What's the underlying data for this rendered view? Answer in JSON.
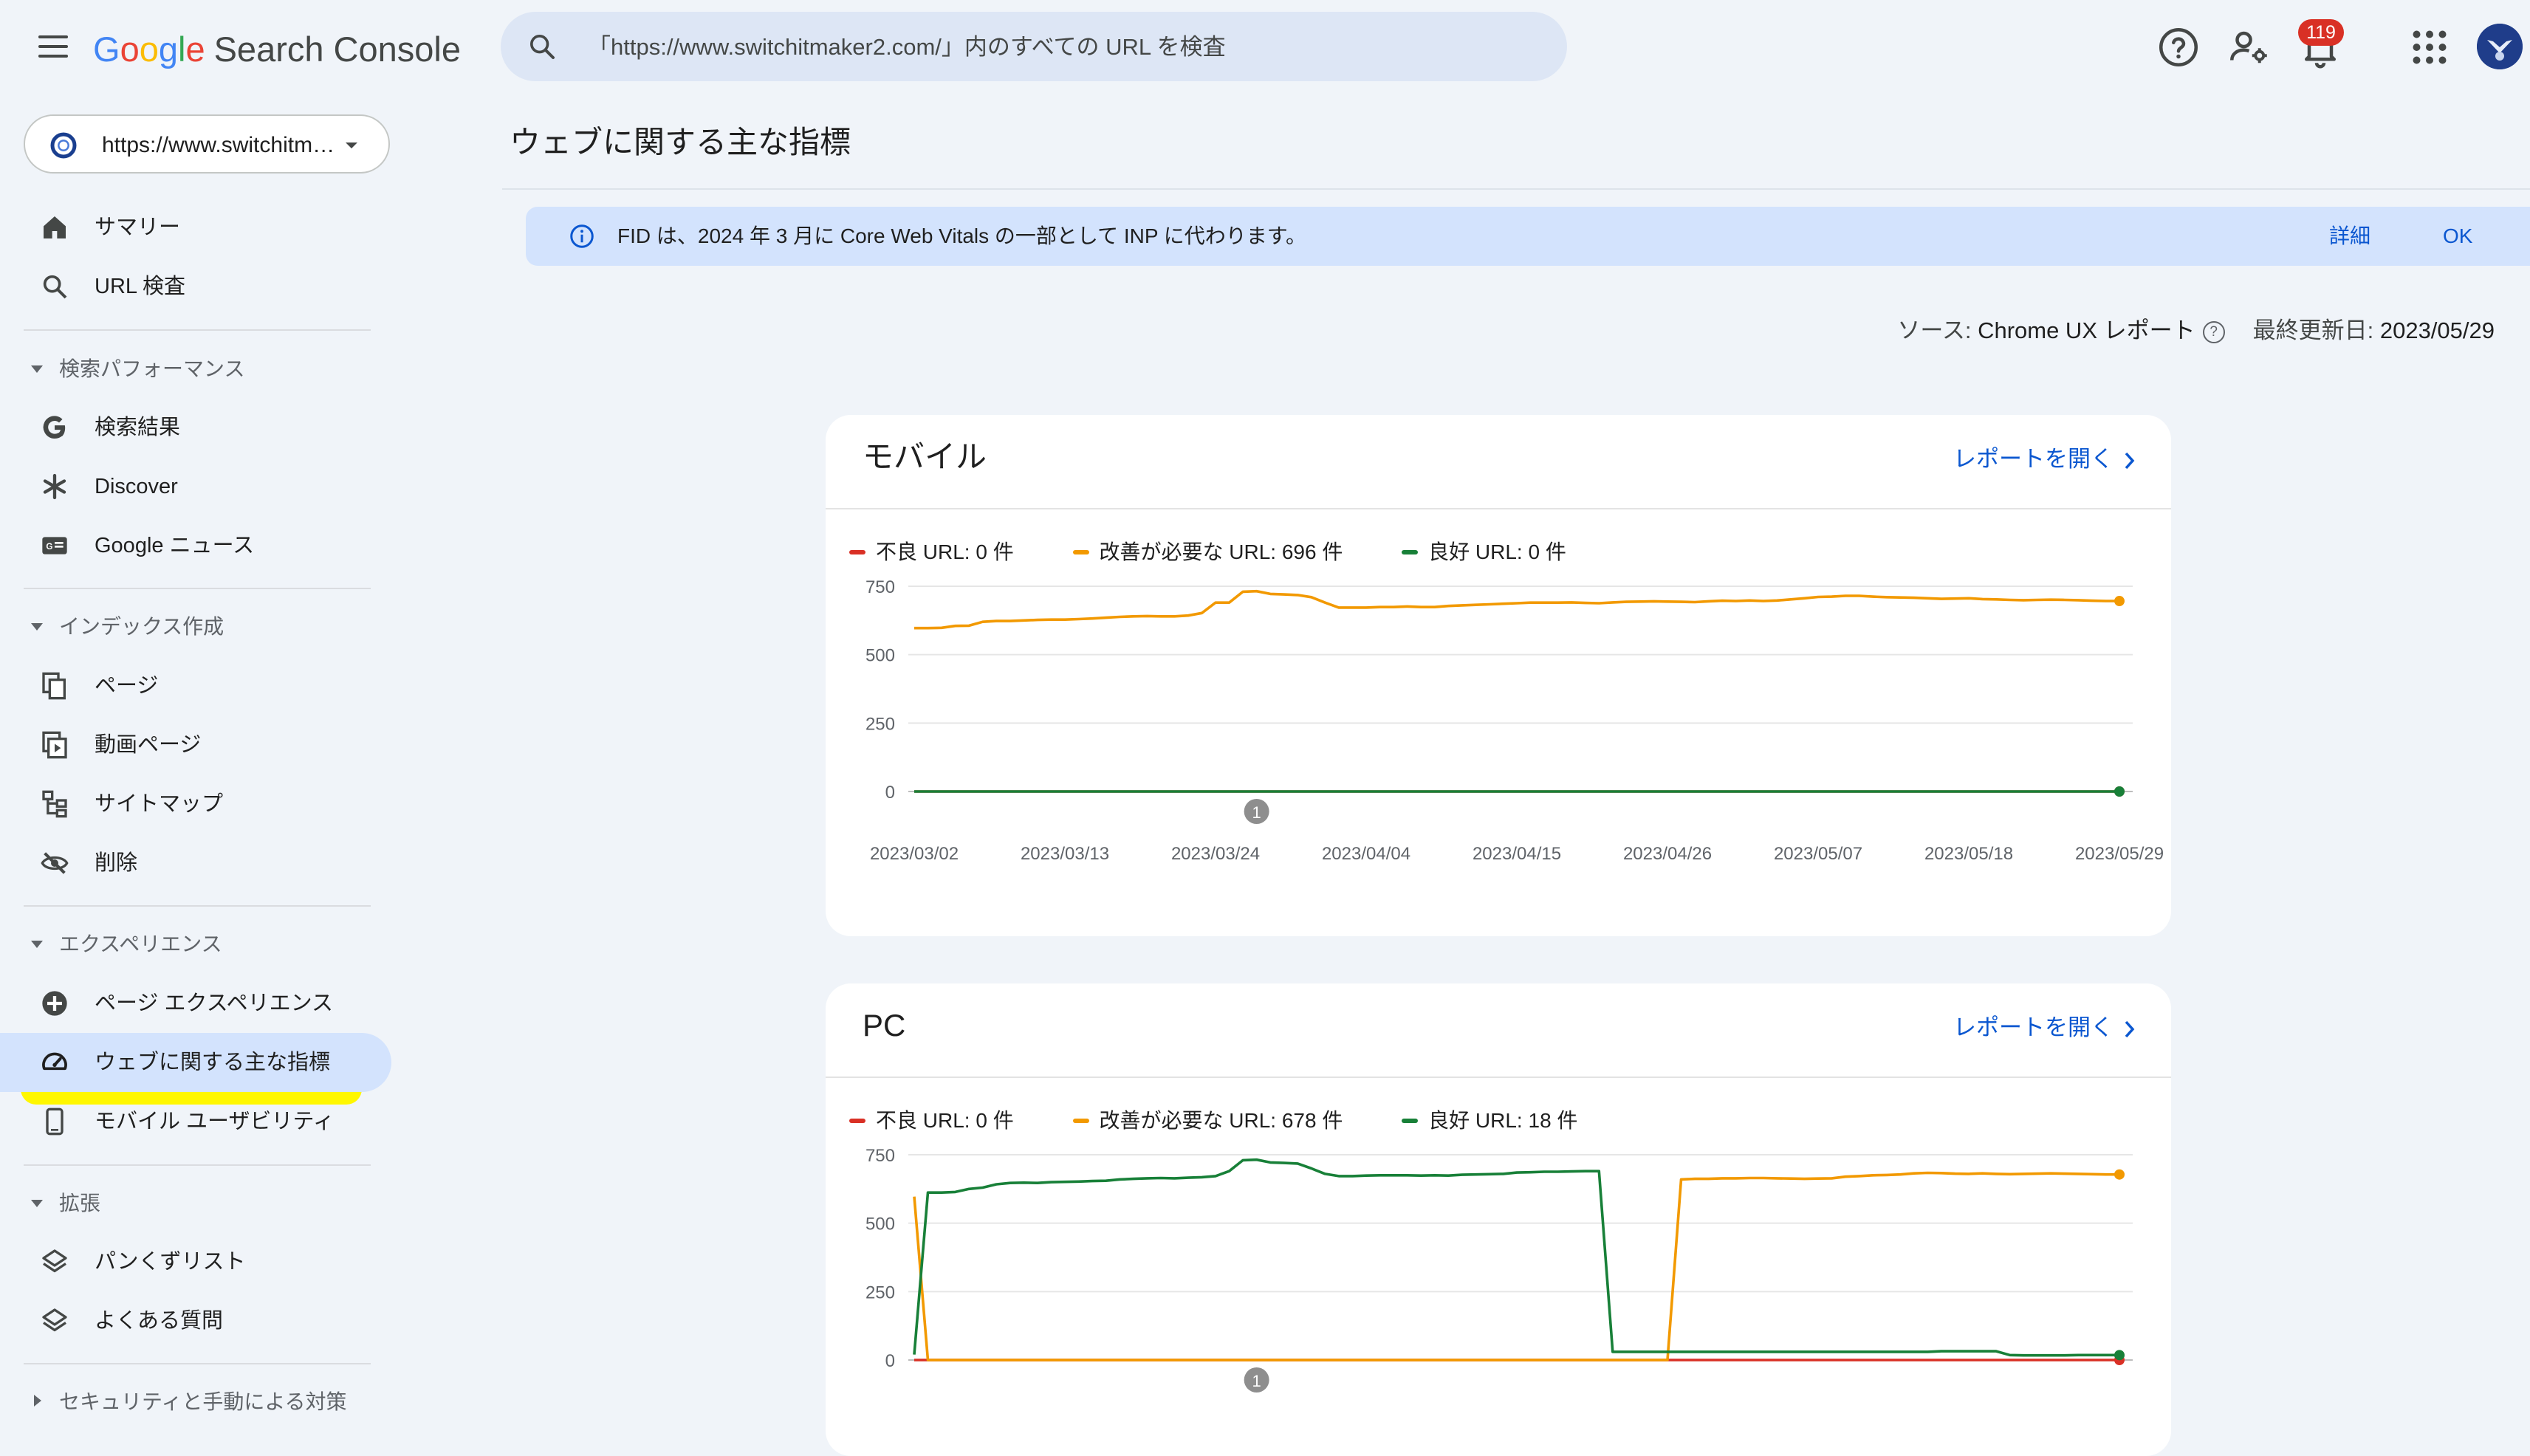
{
  "header": {
    "logo_letters": [
      "G",
      "o",
      "o",
      "g",
      "l",
      "e"
    ],
    "product": "Search Console",
    "search_placeholder": "「https://www.switchitmaker2.com/」内のすべての URL を検査",
    "notification_count": "119"
  },
  "property": {
    "label": "https://www.switchitmaker2.com/"
  },
  "sidebar": {
    "top_items": [
      {
        "label": "サマリー",
        "icon": "home-icon"
      },
      {
        "label": "URL 検査",
        "icon": "search-icon"
      }
    ],
    "sections": [
      {
        "title": "検索パフォーマンス",
        "items": [
          {
            "label": "検索結果",
            "icon": "google-g-icon"
          },
          {
            "label": "Discover",
            "icon": "asterisk-icon"
          },
          {
            "label": "Google ニュース",
            "icon": "google-news-icon"
          }
        ]
      },
      {
        "title": "インデックス作成",
        "items": [
          {
            "label": "ページ",
            "icon": "pages-icon"
          },
          {
            "label": "動画ページ",
            "icon": "video-pages-icon"
          },
          {
            "label": "サイトマップ",
            "icon": "sitemap-icon"
          },
          {
            "label": "削除",
            "icon": "removal-icon"
          }
        ]
      },
      {
        "title": "エクスペリエンス",
        "items": [
          {
            "label": "ページ エクスペリエンス",
            "icon": "page-experience-icon"
          },
          {
            "label": "ウェブに関する主な指標",
            "icon": "gauge-icon",
            "active": true
          },
          {
            "label": "モバイル ユーザビリティ",
            "icon": "smartphone-icon"
          }
        ]
      },
      {
        "title": "拡張",
        "items": [
          {
            "label": "パンくずリスト",
            "icon": "layers-icon"
          },
          {
            "label": "よくある質問",
            "icon": "layers-icon"
          }
        ]
      },
      {
        "title": "セキュリティと手動による対策",
        "collapsed": true,
        "items": []
      }
    ]
  },
  "main": {
    "title": "ウェブに関する主な指標",
    "banner": {
      "text": "FID は、2024 年 3 月に Core Web Vitals の一部として INP に代わります。",
      "link1": "詳細",
      "link2": "OK"
    },
    "source_label": "ソース: ",
    "source_value": "Chrome UX レポート",
    "updated_label": "最終更新日: ",
    "updated_value": "2023/05/29",
    "open_report": "レポートを開く"
  },
  "colors": {
    "poor": "#d93025",
    "needs": "#f29900",
    "good": "#188038",
    "accent": "#0b57d0"
  },
  "chart_data": [
    {
      "type": "line",
      "title": "モバイル",
      "ylim": [
        0,
        750
      ],
      "yticks": [
        "0",
        "250",
        "500",
        "750"
      ],
      "x_labels": [
        "2023/03/02",
        "2023/03/13",
        "2023/03/24",
        "2023/04/04",
        "2023/04/15",
        "2023/04/26",
        "2023/05/07",
        "2023/05/18",
        "2023/05/29"
      ],
      "annotation": {
        "label": "1",
        "at": "2023/03/27"
      },
      "legend": [
        "不良 URL: 0 件",
        "改善が必要な URL: 696 件",
        "良好 URL: 0 件"
      ],
      "series": [
        {
          "name": "不良 URL",
          "color": "#d93025",
          "values": [
            0,
            0,
            0,
            0,
            0,
            0,
            0,
            0,
            0,
            0,
            0,
            0,
            0,
            0,
            0,
            0,
            0,
            0,
            0,
            0,
            0,
            0,
            0,
            0,
            0,
            0,
            0,
            0,
            0,
            0,
            0,
            0,
            0,
            0,
            0,
            0,
            0,
            0,
            0,
            0,
            0,
            0,
            0,
            0,
            0,
            0,
            0,
            0,
            0,
            0,
            0,
            0,
            0,
            0,
            0,
            0,
            0,
            0,
            0,
            0,
            0,
            0,
            0,
            0,
            0,
            0,
            0,
            0,
            0,
            0,
            0,
            0,
            0,
            0,
            0,
            0,
            0,
            0,
            0,
            0,
            0,
            0,
            0,
            0,
            0,
            0,
            0,
            0,
            0
          ]
        },
        {
          "name": "改善が必要な URL",
          "color": "#f29900",
          "values": [
            597,
            597,
            598,
            605,
            606,
            620,
            623,
            623,
            625,
            627,
            628,
            628,
            630,
            632,
            635,
            638,
            640,
            641,
            640,
            640,
            643,
            652,
            690,
            690,
            730,
            732,
            722,
            720,
            718,
            710,
            690,
            672,
            672,
            672,
            674,
            674,
            676,
            674,
            674,
            678,
            680,
            682,
            684,
            686,
            688,
            690,
            690,
            690,
            691,
            689,
            688,
            691,
            693,
            694,
            695,
            694,
            693,
            692,
            695,
            697,
            696,
            698,
            696,
            698,
            702,
            706,
            711,
            712,
            715,
            715,
            712,
            710,
            709,
            708,
            706,
            704,
            705,
            706,
            703,
            702,
            700,
            699,
            700,
            701,
            700,
            699,
            697,
            696,
            696
          ]
        },
        {
          "name": "良好 URL",
          "color": "#188038",
          "values": [
            0,
            0,
            0,
            0,
            0,
            0,
            0,
            0,
            0,
            0,
            0,
            0,
            0,
            0,
            0,
            0,
            0,
            0,
            0,
            0,
            0,
            0,
            0,
            0,
            0,
            0,
            0,
            0,
            0,
            0,
            0,
            0,
            0,
            0,
            0,
            0,
            0,
            0,
            0,
            0,
            0,
            0,
            0,
            0,
            0,
            0,
            0,
            0,
            0,
            0,
            0,
            0,
            0,
            0,
            0,
            0,
            0,
            0,
            0,
            0,
            0,
            0,
            0,
            0,
            0,
            0,
            0,
            0,
            0,
            0,
            0,
            0,
            0,
            0,
            0,
            0,
            0,
            0,
            0,
            0,
            0,
            0,
            0,
            0,
            0,
            0,
            0,
            0,
            0
          ]
        }
      ]
    },
    {
      "type": "line",
      "title": "PC",
      "ylim": [
        0,
        750
      ],
      "yticks": [
        "0",
        "250",
        "500",
        "750"
      ],
      "x_labels": [],
      "annotation": {
        "label": "1",
        "at": "2023/03/27"
      },
      "legend": [
        "不良 URL: 0 件",
        "改善が必要な URL: 678 件",
        "良好 URL: 18 件"
      ],
      "series": [
        {
          "name": "不良 URL",
          "color": "#d93025",
          "values": [
            0,
            0,
            0,
            0,
            0,
            0,
            0,
            0,
            0,
            0,
            0,
            0,
            0,
            0,
            0,
            0,
            0,
            0,
            0,
            0,
            0,
            0,
            0,
            0,
            0,
            0,
            0,
            0,
            0,
            0,
            0,
            0,
            0,
            0,
            0,
            0,
            0,
            0,
            0,
            0,
            0,
            0,
            0,
            0,
            0,
            0,
            0,
            0,
            0,
            0,
            0,
            0,
            0,
            0,
            0,
            0,
            0,
            0,
            0,
            0,
            0,
            0,
            0,
            0,
            0,
            0,
            0,
            0,
            0,
            0,
            0,
            0,
            0,
            0,
            0,
            0,
            0,
            0,
            0,
            0,
            0,
            0,
            0,
            0,
            0,
            0,
            0,
            0,
            0
          ]
        },
        {
          "name": "改善が必要な URL",
          "color": "#f29900",
          "values": [
            597,
            0,
            0,
            0,
            0,
            0,
            0,
            0,
            0,
            0,
            0,
            0,
            0,
            0,
            0,
            0,
            0,
            0,
            0,
            0,
            0,
            0,
            0,
            0,
            0,
            0,
            0,
            0,
            0,
            0,
            0,
            0,
            0,
            0,
            0,
            0,
            0,
            0,
            0,
            0,
            0,
            0,
            0,
            0,
            0,
            0,
            0,
            0,
            0,
            0,
            0,
            0,
            0,
            0,
            0,
            0,
            660,
            662,
            662,
            664,
            664,
            665,
            665,
            664,
            663,
            662,
            663,
            664,
            670,
            672,
            675,
            676,
            678,
            682,
            684,
            683,
            681,
            680,
            682,
            680,
            679,
            680,
            681,
            682,
            681,
            680,
            679,
            678,
            678
          ]
        },
        {
          "name": "良好 URL",
          "color": "#188038",
          "values": [
            20,
            612,
            612,
            614,
            625,
            630,
            642,
            647,
            648,
            647,
            650,
            651,
            652,
            654,
            655,
            660,
            662,
            664,
            665,
            664,
            666,
            668,
            672,
            690,
            730,
            732,
            722,
            720,
            718,
            700,
            680,
            672,
            672,
            674,
            675,
            675,
            675,
            674,
            675,
            674,
            677,
            678,
            679,
            680,
            685,
            686,
            688,
            688,
            689,
            690,
            690,
            30,
            30,
            30,
            30,
            30,
            30,
            30,
            30,
            30,
            30,
            30,
            30,
            30,
            30,
            30,
            30,
            30,
            30,
            30,
            30,
            30,
            30,
            30,
            30,
            32,
            32,
            32,
            32,
            32,
            18,
            17,
            17,
            17,
            17,
            18,
            18,
            18,
            18
          ]
        }
      ]
    }
  ]
}
